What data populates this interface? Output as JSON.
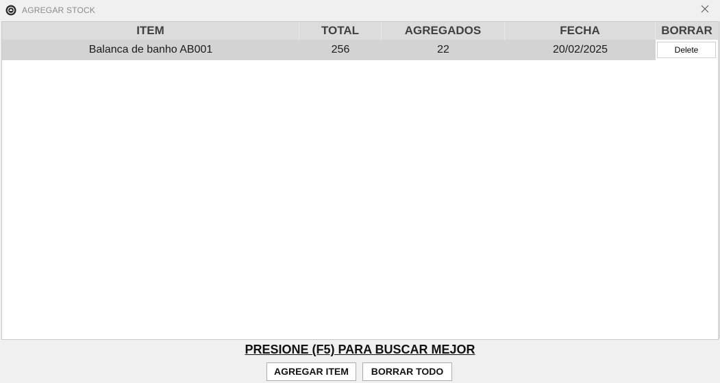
{
  "window": {
    "title": "AGREGAR STOCK",
    "app_icon": "app-logo-icon",
    "close_icon": "close-icon"
  },
  "table": {
    "columns": [
      "ITEM",
      "TOTAL",
      "AGREGADOS",
      "FECHA",
      "BORRAR"
    ],
    "rows": [
      {
        "item": "Balanca de banho AB001",
        "total": "256",
        "agregados": "22",
        "fecha": "20/02/2025",
        "borrar": "Delete"
      }
    ]
  },
  "footer": {
    "hint": "PRESIONE (F5) PARA BUSCAR MEJOR",
    "add_label": "AGREGAR ITEM",
    "clear_label": "BORRAR TODO"
  },
  "colors": {
    "header_bg": "#dcdcdc",
    "row_selected_bg": "#d3d3d3",
    "window_bg": "#f0f0f0"
  }
}
